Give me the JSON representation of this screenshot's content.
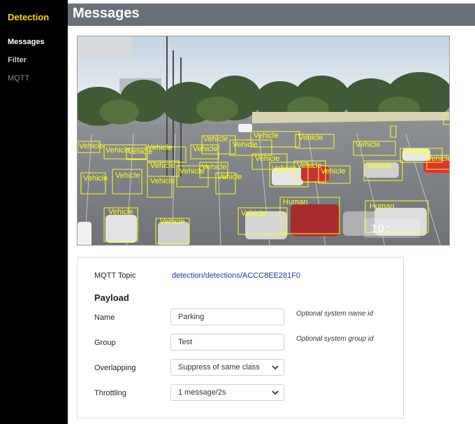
{
  "sidebar": {
    "brand": "Detection",
    "items": [
      {
        "label": "Messages"
      },
      {
        "label": "Filter"
      },
      {
        "label": "MQTT"
      }
    ]
  },
  "header": {
    "title": "Messages"
  },
  "camera": {
    "detections": [
      {
        "label": "Vehicle"
      },
      {
        "label": "Vehicle"
      },
      {
        "label": "Vehicle"
      },
      {
        "label": "Vehicle"
      },
      {
        "label": "Vehicle"
      },
      {
        "label": "Vehicle"
      },
      {
        "label": "Vehicle"
      },
      {
        "label": "Vehicle"
      },
      {
        "label": "Vehicle"
      },
      {
        "label": "Vehicle"
      },
      {
        "label": "Vehicle"
      },
      {
        "label": "Vehicle"
      },
      {
        "label": "Vehicle"
      },
      {
        "label": "Vehicle"
      },
      {
        "label": "Vehicle"
      },
      {
        "label": "Vehicle"
      },
      {
        "label": "Vehicle"
      },
      {
        "label": "Vehicle"
      },
      {
        "label": "Vehicle"
      },
      {
        "label": "Vehicle"
      },
      {
        "label": "Vehicle"
      },
      {
        "label": "Vehicle"
      },
      {
        "label": "Vehicle"
      },
      {
        "label": "Vehicle"
      },
      {
        "label": "Vehicle"
      },
      {
        "label": "Vehicle"
      },
      {
        "label": "Vehicle"
      },
      {
        "label": "Human"
      },
      {
        "label": "Human"
      }
    ],
    "box_color": "#ffff1a",
    "overlay_text": "ID:"
  },
  "panel": {
    "topic_label": "MQTT Topic",
    "topic_value": "detection/detections/ACCC8EE281F0",
    "payload_title": "Payload",
    "name": {
      "label": "Name",
      "value": "Parking",
      "hint": "Optional system name id"
    },
    "group": {
      "label": "Group",
      "value": "Test",
      "hint": "Optional system group id"
    },
    "overlapping": {
      "label": "Overlapping",
      "selected": "Suppress of same class"
    },
    "throttling": {
      "label": "Throttling",
      "selected": "1 message/2s"
    }
  },
  "colors": {
    "sidebar_bg": "#000000",
    "brand": "#ffd700",
    "header_bg": "#68717a",
    "link": "#1f3aa6"
  }
}
